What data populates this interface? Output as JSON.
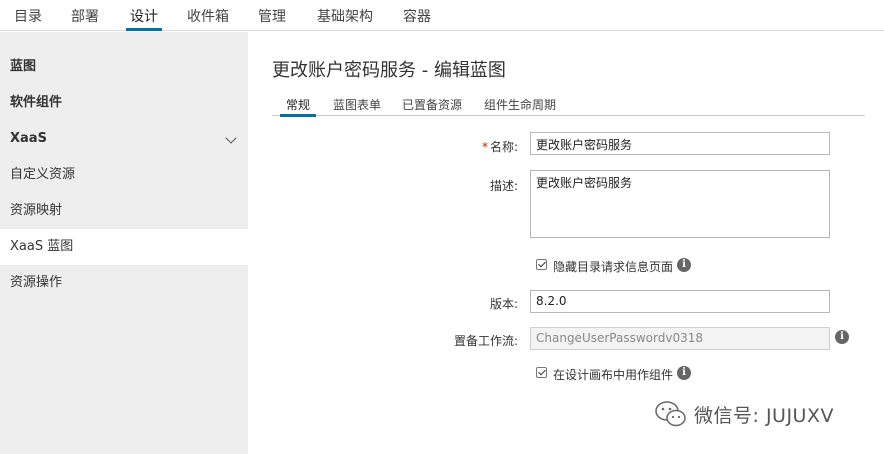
{
  "topnav": {
    "tabs": [
      {
        "label": "目录"
      },
      {
        "label": "部署"
      },
      {
        "label": "设计"
      },
      {
        "label": "收件箱"
      },
      {
        "label": "管理"
      },
      {
        "label": "基础架构"
      },
      {
        "label": "容器"
      }
    ],
    "active_index": 2
  },
  "sidebar": {
    "items": [
      {
        "label": "蓝图"
      },
      {
        "label": "软件组件"
      },
      {
        "label": "XaaS"
      },
      {
        "label": "自定义资源"
      },
      {
        "label": "资源映射"
      },
      {
        "label": "XaaS 蓝图"
      },
      {
        "label": "资源操作"
      }
    ],
    "selected_index": 5
  },
  "main": {
    "title": "更改账户密码服务 - 编辑蓝图",
    "tabs": [
      {
        "label": "常规"
      },
      {
        "label": "蓝图表单"
      },
      {
        "label": "已置备资源"
      },
      {
        "label": "组件生命周期"
      }
    ],
    "active_tab": 0,
    "form": {
      "name_label": "名称:",
      "name_required_mark": "*",
      "name_value": "更改账户密码服务",
      "desc_label": "描述:",
      "desc_value": "更改账户密码服务",
      "hide_catalog_label": "隐藏目录请求信息页面",
      "hide_catalog_checked": true,
      "version_label": "版本:",
      "version_value": "8.2.0",
      "workflow_label": "置备工作流:",
      "workflow_value": "ChangeUserPasswordv0318",
      "use_in_canvas_label": "在设计画布中用作组件",
      "use_in_canvas_checked": true
    }
  },
  "watermark": {
    "text": "微信号: JUJUXV"
  },
  "colors": {
    "accent": "#0072a3",
    "sidebar_bg": "#eeeeee",
    "required": "#c92100"
  }
}
